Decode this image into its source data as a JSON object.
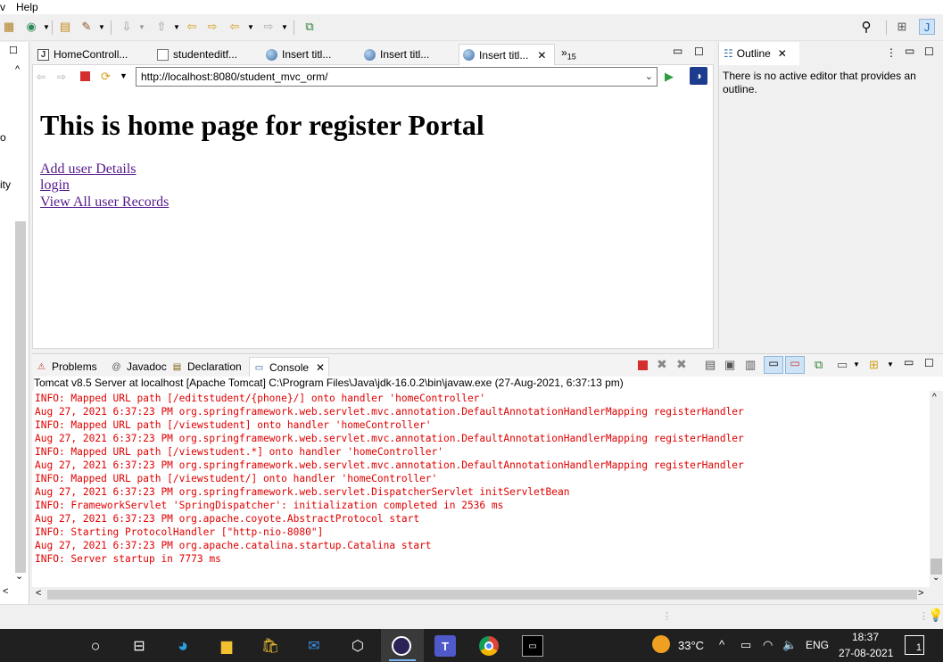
{
  "menubar": {
    "partial_item": "v",
    "help_label": "Help"
  },
  "toolbar": {
    "icons": [
      "package-icon",
      "run-icon",
      "open-icon",
      "edit-icon",
      "next-annotation-icon",
      "prev-annotation-icon",
      "back-edit-icon",
      "forward-edit-icon",
      "back-icon",
      "forward-icon",
      "open-task-icon",
      "search-icon",
      "perspective-icon",
      "java-perspective-icon"
    ]
  },
  "left_panel": {
    "fragments": [
      "o",
      "ity"
    ]
  },
  "editor_tabs": [
    {
      "label": "HomeControll...",
      "icon": "java-file-icon"
    },
    {
      "label": "studenteditf...",
      "icon": "jsp-file-icon"
    },
    {
      "label": "Insert titl...",
      "icon": "globe-icon"
    },
    {
      "label": "Insert titl...",
      "icon": "globe-icon"
    },
    {
      "label": "Insert titl...",
      "icon": "globe-icon",
      "active": true
    }
  ],
  "overflow": {
    "chevron": "»",
    "count": "15"
  },
  "browser": {
    "url": "http://localhost:8080/student_mvc_orm/",
    "heading": "This is home page for register Portal",
    "links": [
      "Add user Details",
      "login",
      "View All user Records"
    ]
  },
  "outline": {
    "title": "Outline",
    "message": "There is no active editor that provides an outline."
  },
  "console_tabs": [
    {
      "label": "Problems",
      "icon": "problems-icon"
    },
    {
      "label": "Javadoc",
      "icon": "javadoc-icon"
    },
    {
      "label": "Declaration",
      "icon": "declaration-icon"
    },
    {
      "label": "Console",
      "icon": "console-icon",
      "active": true
    }
  ],
  "console": {
    "description": "Tomcat v8.5 Server at localhost [Apache Tomcat] C:\\Program Files\\Java\\jdk-16.0.2\\bin\\javaw.exe  (27-Aug-2021, 6:37:13 pm)",
    "lines": [
      "INFO: Mapped URL path [/editstudent/{phone}/] onto handler 'homeController'",
      "Aug 27, 2021 6:37:23 PM org.springframework.web.servlet.mvc.annotation.DefaultAnnotationHandlerMapping registerHandler",
      "INFO: Mapped URL path [/viewstudent] onto handler 'homeController'",
      "Aug 27, 2021 6:37:23 PM org.springframework.web.servlet.mvc.annotation.DefaultAnnotationHandlerMapping registerHandler",
      "INFO: Mapped URL path [/viewstudent.*] onto handler 'homeController'",
      "Aug 27, 2021 6:37:23 PM org.springframework.web.servlet.mvc.annotation.DefaultAnnotationHandlerMapping registerHandler",
      "INFO: Mapped URL path [/viewstudent/] onto handler 'homeController'",
      "Aug 27, 2021 6:37:23 PM org.springframework.web.servlet.DispatcherServlet initServletBean",
      "INFO: FrameworkServlet 'SpringDispatcher': initialization completed in 2536 ms",
      "Aug 27, 2021 6:37:23 PM org.apache.coyote.AbstractProtocol start",
      "INFO: Starting ProtocolHandler [\"http-nio-8080\"]",
      "Aug 27, 2021 6:37:23 PM org.apache.catalina.startup.Catalina start",
      "INFO: Server startup in 7773 ms"
    ],
    "text_color": "#e00000"
  },
  "taskbar": {
    "apps": [
      "start-icon",
      "task-view-icon",
      "edge-icon",
      "file-explorer-icon",
      "store-icon",
      "mail-icon",
      "sketch-icon",
      "eclipse-icon",
      "teams-icon",
      "chrome-icon",
      "terminal-icon"
    ],
    "weather": "33°C",
    "language": "ENG",
    "time": "18:37",
    "date": "27-08-2021",
    "notifications": "1"
  },
  "colors": {
    "accent": "#1a73e8",
    "link": "#551a8b",
    "taskbar": "#202020"
  }
}
